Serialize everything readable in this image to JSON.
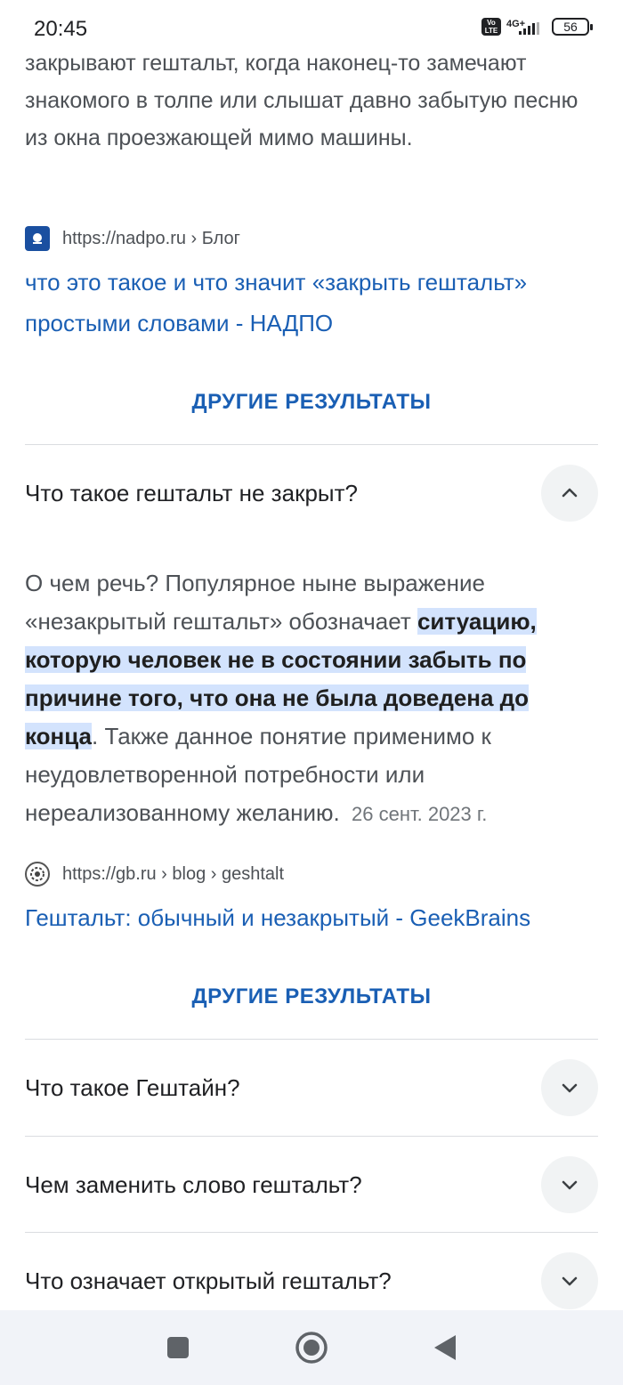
{
  "status_bar": {
    "time": "20:45",
    "volte": "Vo LTE",
    "network": "4G+",
    "battery": "56"
  },
  "top_snippet": "закрывают гештальт, когда наконец-то замечают знакомого в толпе или слышат давно забытую песню из окна проезжающей мимо машины.",
  "result1": {
    "source": "https://nadpo.ru › Блог",
    "title": "что это такое и что значит «закрыть гештальт» простыми словами - НАДПО"
  },
  "more_results_label": "ДРУГИЕ РЕЗУЛЬТАТЫ",
  "questions": [
    {
      "question": "Что такое гештальт не закрыт?",
      "expanded": true,
      "answer_before": "О чем речь? Популярное ныне выражение «незакрытый гештальт» обозначает ",
      "answer_highlight": "ситуацию, которую человек не в состоянии забыть по причине того, что она не была доведена до конца",
      "answer_after": ". Также данное понятие применимо к неудовлетворенной потребности или нереализованному желанию.",
      "date": "26 сент. 2023 г.",
      "source": "https://gb.ru › blog › geshtalt",
      "title": "Гештальт: обычный и незакрытый - GeekBrains"
    },
    {
      "question": "Что такое Гештайн?",
      "expanded": false
    },
    {
      "question": "Чем заменить слово гештальт?",
      "expanded": false
    },
    {
      "question": "Что означает открытый гештальт?",
      "expanded": false
    }
  ],
  "icons": {
    "chevron_up": "chevron-up-icon",
    "chevron_down": "chevron-down-icon",
    "nav_recents": "square-icon",
    "nav_home": "circle-icon",
    "nav_back": "triangle-back-icon"
  },
  "colors": {
    "link": "#1a5fb4",
    "highlight": "#d3e3fd"
  }
}
